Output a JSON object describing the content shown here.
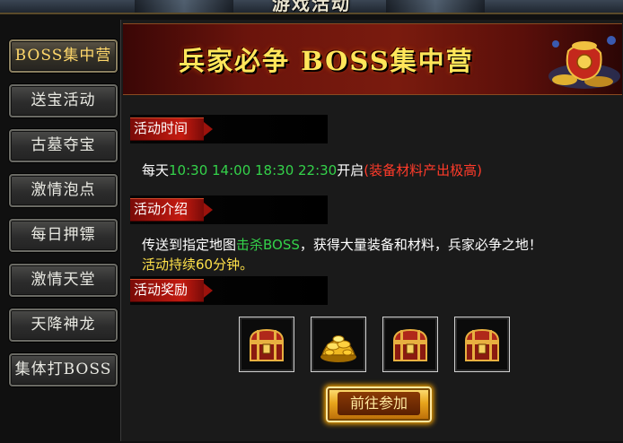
{
  "window": {
    "title": "游戏活动"
  },
  "sidebar": {
    "items": [
      {
        "label": "BOSS集中营",
        "active": true
      },
      {
        "label": "送宝活动"
      },
      {
        "label": "古墓夺宝"
      },
      {
        "label": "激情泡点"
      },
      {
        "label": "每日押镖"
      },
      {
        "label": "激情天堂"
      },
      {
        "label": "天降神龙"
      },
      {
        "label": "集体打BOSS"
      }
    ]
  },
  "banner": {
    "title": "兵家必争 BOSS集中营"
  },
  "sections": {
    "time": {
      "header": "活动时间",
      "prefix": "每天",
      "times": "10:30 14:00 18:30 22:30",
      "suffix": "开启",
      "note": "(装备材料产出极高)"
    },
    "intro": {
      "header": "活动介绍",
      "line1_a": "传送到指定地图",
      "line1_b": "击杀BOSS",
      "line1_c": "，获得大量装备和材料，兵家必争之地！",
      "line2": "活动持续60分钟。"
    },
    "rewards": {
      "header": "活动奖励",
      "items": [
        {
          "icon": "treasure-chest-icon"
        },
        {
          "icon": "gold-ingots-icon"
        },
        {
          "icon": "treasure-chest-icon"
        },
        {
          "icon": "treasure-chest-icon"
        }
      ]
    }
  },
  "actions": {
    "join_label": "前往参加"
  },
  "colors": {
    "highlight_green": "#34d24a",
    "highlight_red": "#ff3b2a",
    "highlight_yellow": "#ffe14a",
    "banner_title": "#ffe65a",
    "header_red": "#c41a10"
  }
}
